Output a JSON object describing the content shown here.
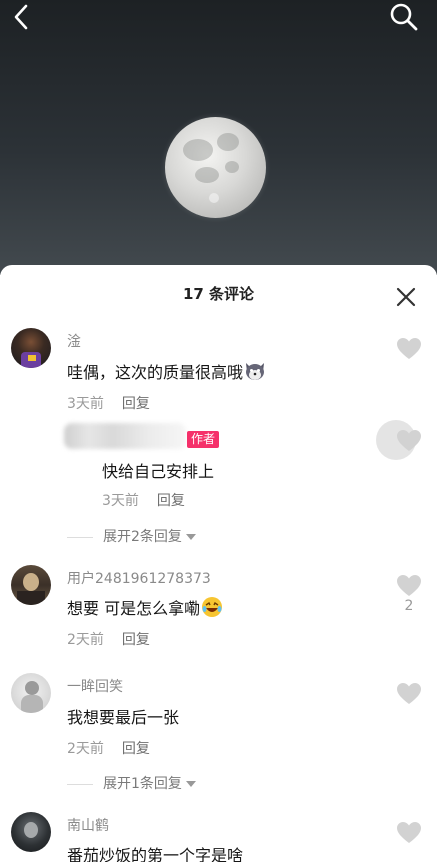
{
  "header": {
    "back_icon": "chevron-left-icon",
    "search_icon": "search-icon"
  },
  "sheet": {
    "title": "17 条评论",
    "close_icon": "close-icon"
  },
  "comments": [
    {
      "user": "淦",
      "text": "哇偶，这次的质量很高哦",
      "emoji": "husky-emoji",
      "time": "3天前",
      "reply": "回复"
    },
    {
      "user": "用户2481961278373",
      "text": "想要 可是怎么拿嘞",
      "emoji": "laughing-emoji",
      "time": "2天前",
      "reply": "回复",
      "likes": "2"
    },
    {
      "user": "一眸回笑",
      "text": "我想要最后一张",
      "time": "2天前",
      "reply": "回复"
    },
    {
      "user": "南山鹤",
      "text": "番茄炒饭的第一个字是啥"
    }
  ],
  "author_reply": {
    "tag": "作者",
    "text": "快给自己安排上",
    "time": "3天前",
    "reply": "回复"
  },
  "expand": {
    "first": "展开2条回复",
    "second": "展开1条回复"
  },
  "colors": {
    "author_tag": "#f5306a",
    "heart": "#d2d2d2"
  }
}
